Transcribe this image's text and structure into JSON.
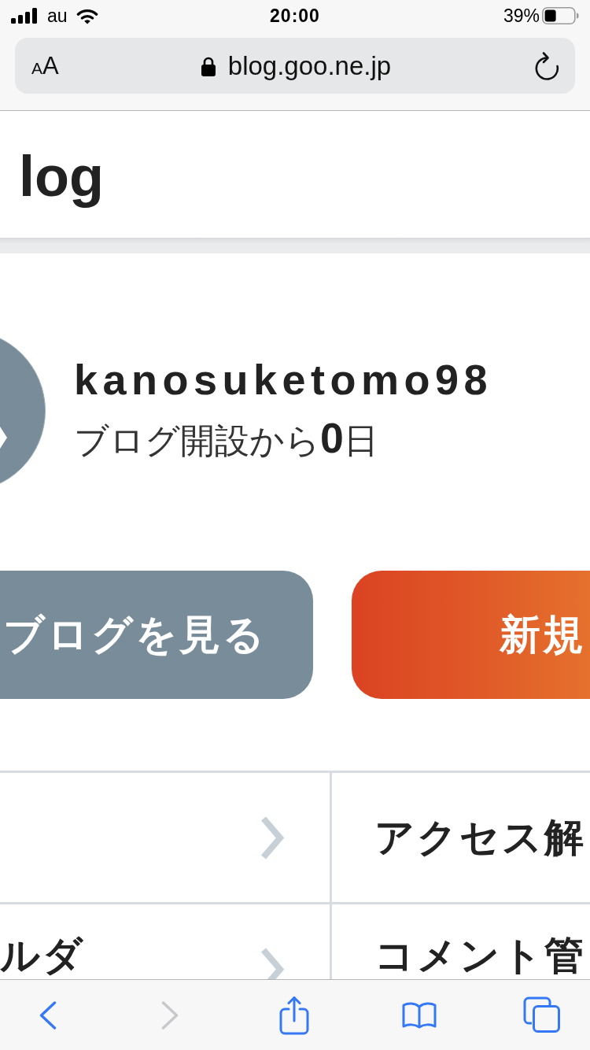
{
  "status_bar": {
    "carrier": "au",
    "time": "20:00",
    "battery": "39%"
  },
  "address_bar": {
    "text_size_button": "AA",
    "url": "blog.goo.ne.jp"
  },
  "header": {
    "title": "log"
  },
  "profile": {
    "username": "kanosuketomo98",
    "days_since_opening": "ブログ開設から**0**日"
  },
  "action_buttons": [
    {
      "label": "ブログを見る",
      "kind": "secondary"
    },
    {
      "label": "新規",
      "kind": "primary"
    }
  ],
  "menu_grid": [
    {
      "right": "アクセス解"
    },
    {
      "left": "ルダ",
      "right": "コメント管"
    }
  ],
  "toolbar": [
    {
      "kind": "back",
      "disabled": false
    },
    {
      "kind": "forward",
      "disabled": true
    },
    {
      "kind": "share",
      "disabled": false
    },
    {
      "kind": "bookmarks",
      "disabled": false
    },
    {
      "kind": "tabs",
      "disabled": false
    }
  ]
}
